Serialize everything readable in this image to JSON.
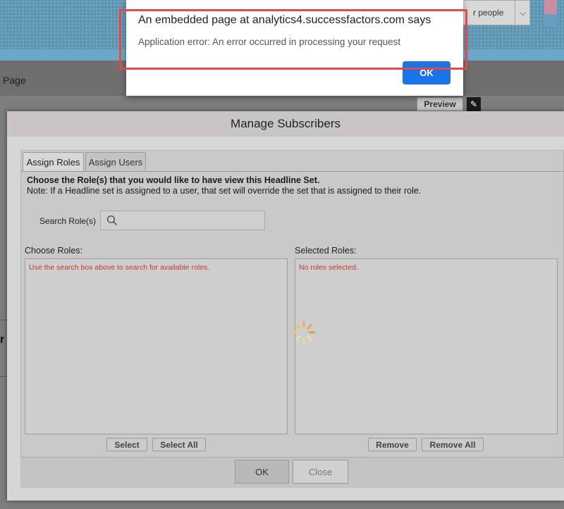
{
  "background": {
    "search_placeholder_partial": "r people",
    "page_label": "Page",
    "preview_label": "Preview",
    "edge_letter": "r"
  },
  "modal": {
    "title": "Manage Subscribers",
    "tabs": [
      {
        "label": "Assign Roles",
        "active": true
      },
      {
        "label": "Assign Users",
        "active": false
      }
    ],
    "heading": "Choose the Role(s) that you would like to have view this Headline Set.",
    "note": "Note: If a Headline set is assigned to a user, that set will override the set that is assigned to their role.",
    "search_label": "Search Role(s)",
    "search_value": "",
    "choose_roles": {
      "label": "Choose Roles:",
      "message": "Use the search box above to search for available roles.",
      "buttons": [
        "Select",
        "Select All"
      ]
    },
    "selected_roles": {
      "label": "Selected Roles:",
      "message": "No roles selected.",
      "buttons": [
        "Remove",
        "Remove All"
      ]
    },
    "footer": {
      "ok_label": "OK",
      "close_label": "Close"
    }
  },
  "alert": {
    "title": "An embedded page at analytics4.successfactors.com says",
    "message": "Application error: An error occurred in processing your request",
    "ok_label": "OK"
  },
  "colors": {
    "alert_button": "#1a73e8",
    "error_text": "#c13a28",
    "highlight": "#e04a4a",
    "header_bg": "#5f95b4"
  }
}
